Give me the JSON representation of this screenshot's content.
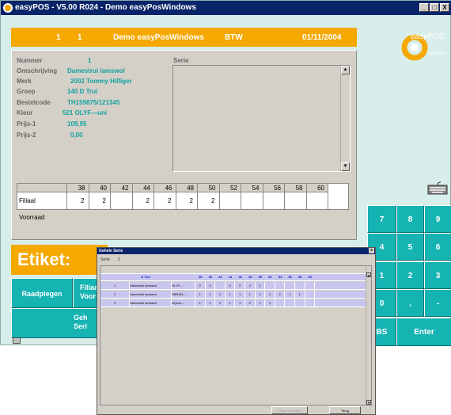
{
  "window": {
    "title": "easyPOS - V5.00 R024 - Demo easyPosWindows",
    "min": "_",
    "max": "□",
    "close": "X"
  },
  "header": {
    "c1": "1",
    "c2": "1",
    "company": "Demo easyPosWindows",
    "btw": "BTW",
    "date": "01/11/2004"
  },
  "logo": {
    "brand": "easyPOS",
    "sub": "software",
    "accent": "#f4a800",
    "teal": "#13a2a2"
  },
  "article": {
    "fields": [
      {
        "label": "Nummer",
        "value": "1"
      },
      {
        "label": "Omschrijving",
        "value": "Damestrui lamswol"
      },
      {
        "label": "Merk",
        "value": "2002 Tommy Hilfiger"
      },
      {
        "label": "Groep",
        "value": "140 D Trui"
      },
      {
        "label": "Bestelcode",
        "value": "TH159875/121345"
      },
      {
        "label": "Kleur",
        "value": "521 OLYF---uni"
      },
      {
        "label": "Prijs-1",
        "value": "109,95"
      },
      {
        "label": "Prijs-2",
        "value": "0,00"
      }
    ],
    "serie_label": "Serie"
  },
  "stock": {
    "sizes": [
      "38",
      "40",
      "42",
      "44",
      "46",
      "48",
      "50",
      "52",
      "54",
      "56",
      "58",
      "60"
    ],
    "row_label": "Filiaal Voorraad",
    "values": [
      "2",
      "2",
      "",
      "2",
      "2",
      "2",
      "2",
      "",
      "",
      "",
      "",
      ""
    ]
  },
  "etiket": "Etiket:",
  "buttons": {
    "raadplegen": "Raadplegen",
    "filiaal": "Filiaa",
    "filiaal2": "Voor",
    "gehele": "Geh",
    "gehele2": "Seri"
  },
  "keypad": [
    "7",
    "8",
    "9",
    "4",
    "5",
    "6",
    "1",
    "2",
    "3",
    "0",
    ",",
    "-"
  ],
  "keypad_bs": "BS",
  "keypad_enter": "Enter",
  "dialog": {
    "title": "Gehele Serie",
    "serie_label": "Serie",
    "serie_value": "2",
    "group": "D Trui",
    "sizes": [
      "38",
      "40",
      "42",
      "44",
      "46",
      "48",
      "50",
      "52",
      "54",
      "56",
      "58",
      "60"
    ],
    "rows": [
      {
        "nr": "1",
        "desc": "Damestrui lamswol",
        "color": "OLYF---",
        "values": [
          "2",
          "2",
          "",
          "2",
          "2",
          "2",
          "2",
          "",
          "",
          "",
          "",
          ""
        ]
      },
      {
        "nr": "2",
        "desc": "Damestrui lamswol",
        "color": "DBRUN-...",
        "values": [
          "1",
          "1",
          "1",
          "1",
          "1",
          "1",
          "1",
          "1",
          "2",
          "1",
          "1",
          ""
        ]
      },
      {
        "nr": "3",
        "desc": "Damestrui lamswol",
        "color": "AQUA---",
        "values": [
          "1",
          "1",
          "1",
          "1",
          "1",
          "2",
          "1",
          "1",
          "",
          "",
          "",
          ""
        ]
      }
    ],
    "btn_disabled": "Filiaal Voorraad",
    "btn_terug": "Terug"
  }
}
